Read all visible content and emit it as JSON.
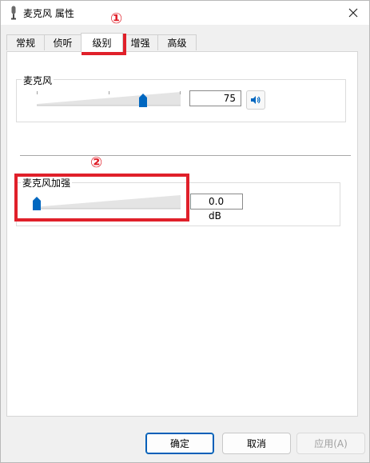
{
  "window": {
    "title": "麦克风 属性"
  },
  "tabs": [
    {
      "label": "常规"
    },
    {
      "label": "侦听"
    },
    {
      "label": "级别"
    },
    {
      "label": "增强"
    },
    {
      "label": "高级"
    }
  ],
  "mic_level": {
    "label": "麦克风",
    "value_text": "75",
    "level": 0.75
  },
  "mic_boost": {
    "label": "麦克风加强",
    "value_text": "0.0 dB",
    "level": 0.0
  },
  "annotations": {
    "one": "①",
    "two": "②"
  },
  "buttons": {
    "ok": "确定",
    "cancel": "取消",
    "apply": "应用(A)"
  },
  "colors": {
    "accent": "#0067c0",
    "annotation": "#e0202a"
  }
}
